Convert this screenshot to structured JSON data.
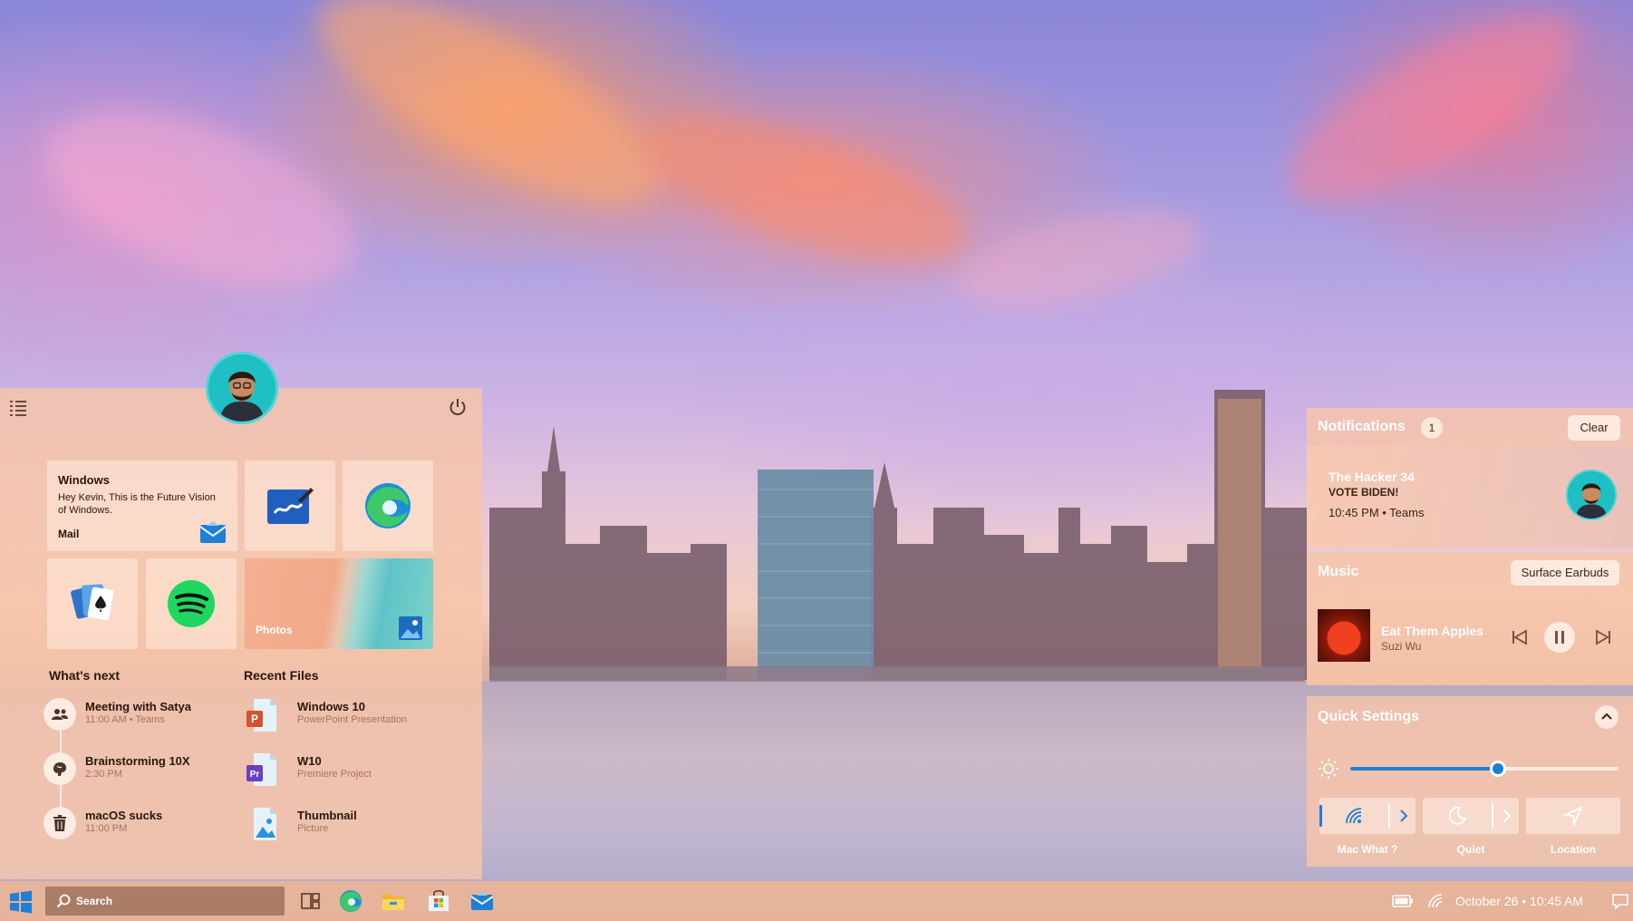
{
  "start_menu": {
    "tiles": {
      "mail": {
        "title": "Windows",
        "body": "Hey Kevin, This is the Future Vision of Windows.",
        "app": "Mail"
      },
      "photos": {
        "app": "Photos"
      }
    },
    "whats_next": {
      "heading": "What's next",
      "items": [
        {
          "title": "Meeting with Satya",
          "subtitle": "11:00 AM • Teams",
          "icon": "people-icon"
        },
        {
          "title": "Brainstorming 10X",
          "subtitle": "2:30 PM",
          "icon": "brain-icon"
        },
        {
          "title": "macOS sucks",
          "subtitle": "11:00 PM",
          "icon": "trash-icon"
        }
      ]
    },
    "recent_files": {
      "heading": "Recent Files",
      "items": [
        {
          "title": "Windows 10",
          "subtitle": "PowerPoint Presentation",
          "icon": "powerpoint-file-icon"
        },
        {
          "title": "W10",
          "subtitle": "Premiere Project",
          "icon": "premiere-file-icon"
        },
        {
          "title": "Thumbnail",
          "subtitle": "Picture",
          "icon": "picture-file-icon"
        }
      ]
    }
  },
  "notifications": {
    "title": "Notifications",
    "count": "1",
    "clear_label": "Clear",
    "item": {
      "sender": "The Hacker 34",
      "message": "VOTE BIDEN!",
      "time": "10:45 PM • Teams"
    }
  },
  "music": {
    "title": "Music",
    "output_device": "Surface Earbuds",
    "track": "Eat Them Apples",
    "artist": "Suzi Wu"
  },
  "quick_settings": {
    "title": "Quick Settings",
    "brightness": 0.55,
    "toggles": {
      "wifi": "Mac What ?",
      "quiet": "Quiet",
      "location": "Location"
    }
  },
  "taskbar": {
    "search_placeholder": "Search",
    "clock": "October 26 • 10:45 AM",
    "apps": [
      "task-view-icon",
      "edge-icon",
      "file-explorer-icon",
      "store-icon",
      "mail-icon"
    ]
  },
  "colors": {
    "accent": "#1f7fd6",
    "panel": "#f6c4a8",
    "avatar_bg": "#1ec0c4"
  }
}
